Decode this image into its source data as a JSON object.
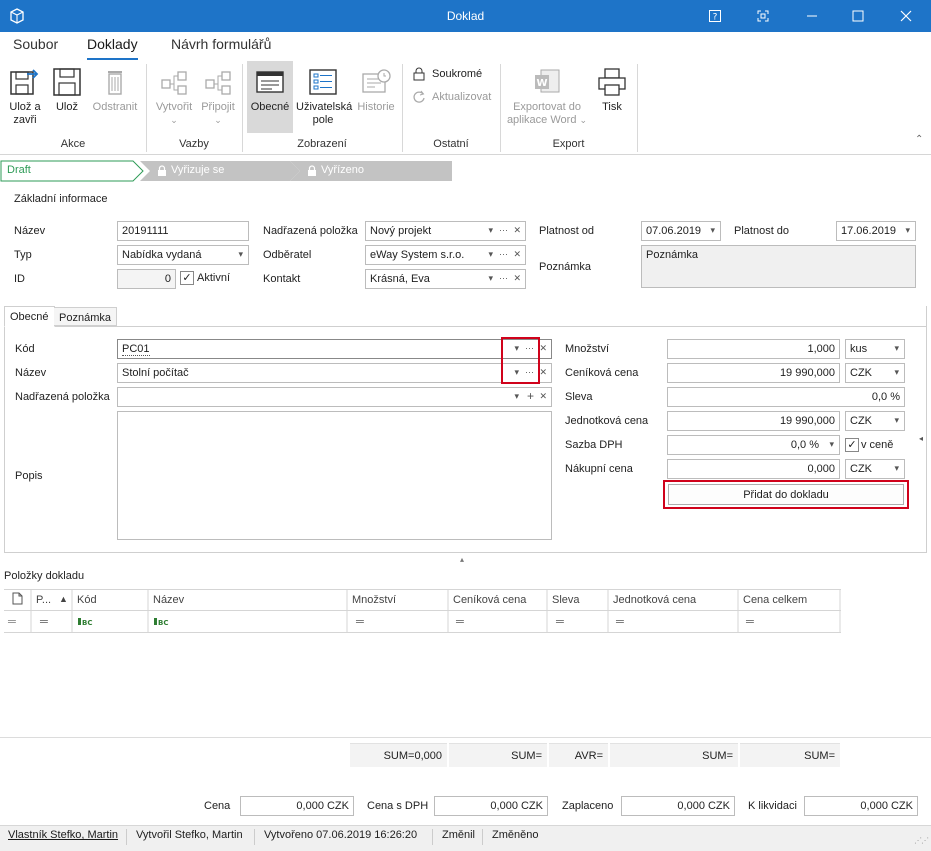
{
  "window": {
    "title": "Doklad"
  },
  "ribbon_tabs": [
    "Soubor",
    "Doklady",
    "Návrh formulářů"
  ],
  "ribbon": {
    "akce": {
      "label": "Akce",
      "uloz_a_zavri": "Ulož a zavři",
      "uloz": "Ulož",
      "odstranit": "Odstranit"
    },
    "vazby": {
      "label": "Vazby",
      "vytvorit": "Vytvořit",
      "pripojit": "Připojit"
    },
    "zobrazeni": {
      "label": "Zobrazení",
      "obecne": "Obecné",
      "uzivatelska_pole": "Uživatelská pole",
      "historie": "Historie"
    },
    "ostatni": {
      "label": "Ostatní",
      "soukrome": "Soukromé",
      "aktualizovat": "Aktualizovat"
    },
    "export": {
      "label": "Export",
      "export_word": "Exportovat do aplikace Word",
      "tisk": "Tisk"
    }
  },
  "workflow": [
    "Draft",
    "Vyřizuje se",
    "Vyřízeno"
  ],
  "basic": {
    "section_title": "Základní informace",
    "nazev_label": "Název",
    "nazev_value": "20191111",
    "typ_label": "Typ",
    "typ_value": "Nabídka vydaná",
    "id_label": "ID",
    "id_value": "0",
    "aktivni_label": "Aktivní",
    "nadrazena_label": "Nadřazená položka",
    "nadrazena_value": "Nový projekt",
    "odberatel_label": "Odběratel",
    "odberatel_value": "eWay System s.r.o.",
    "kontakt_label": "Kontakt",
    "kontakt_value": "Krásná, Eva",
    "platnost_od_label": "Platnost od",
    "platnost_od_value": "07.06.2019",
    "platnost_do_label": "Platnost do",
    "platnost_do_value": "17.06.2019",
    "poznamka_label": "Poznámka",
    "poznamka_value": "Poznámka"
  },
  "tabs": [
    "Obecné",
    "Poznámka"
  ],
  "item": {
    "kod_label": "Kód",
    "kod_value": "PC01",
    "nazev_label": "Název",
    "nazev_value": "Stolní počítač",
    "nadrazena_label": "Nadřazená položka",
    "popis_label": "Popis",
    "mnozstvi_label": "Množství",
    "mnozstvi_value": "1,000",
    "mnozstvi_unit": "kus",
    "cenikova_label": "Ceníková cena",
    "cenikova_value": "19 990,000",
    "cenikova_cur": "CZK",
    "sleva_label": "Sleva",
    "sleva_value": "0,0 %",
    "jednotkova_label": "Jednotková cena",
    "jednotkova_value": "19 990,000",
    "jednotkova_cur": "CZK",
    "sazba_label": "Sazba DPH",
    "sazba_value": "0,0 %",
    "v_cene_label": "v ceně",
    "nakupni_label": "Nákupní cena",
    "nakupni_value": "0,000",
    "nakupni_cur": "CZK",
    "add_button": "Přidat do dokladu"
  },
  "items_grid": {
    "title": "Položky dokladu",
    "columns": [
      "P...",
      "Kód",
      "Název",
      "Množství",
      "Ceníková cena",
      "Sleva",
      "Jednotková cena",
      "Cena celkem"
    ],
    "sums": [
      "SUM=0,000",
      "SUM=",
      "AVR=",
      "SUM=",
      "SUM="
    ]
  },
  "totals": {
    "cena_label": "Cena",
    "cena_value": "0,000 CZK",
    "cena_dph_label": "Cena s DPH",
    "cena_dph_value": "0,000 CZK",
    "zaplaceno_label": "Zaplaceno",
    "zaplaceno_value": "0,000 CZK",
    "likvidaci_label": "K likvidaci",
    "likvidaci_value": "0,000 CZK"
  },
  "statusbar": {
    "vlastnik": "Vlastník Stefko, Martin",
    "vytvoril": "Vytvořil Stefko, Martin",
    "vytvoreno": "Vytvořeno 07.06.2019 16:26:20",
    "zmenil": "Změnil",
    "zmeneno": "Změněno"
  },
  "colors": {
    "titlebar": "#1e74c8",
    "highlight_red": "#d0021b",
    "draft_green": "#2e9b57"
  }
}
